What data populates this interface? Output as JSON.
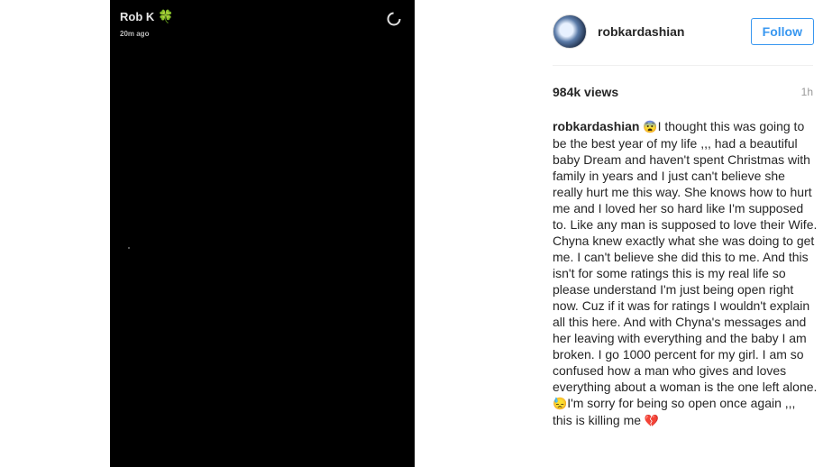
{
  "video_overlay": {
    "name": "Rob K",
    "name_emoji": "🍀",
    "timestamp": "20m ago"
  },
  "header": {
    "username": "robkardashian",
    "follow_label": "Follow"
  },
  "stats": {
    "views": "984k views",
    "age": "1h"
  },
  "caption": {
    "author": "robkardashian",
    "emoji_1": "😨",
    "text_1": "I thought this was going to be the best year of my life ,,, had a beautiful baby Dream and haven't spent Christmas with family in years and I just can't believe she really hurt me this way. She knows how to hurt me and I loved her so hard like I'm supposed to. Like any man is supposed to love their Wife. Chyna knew exactly what she was doing to get me. I can't believe she did this to me. And this isn't for some ratings this is my real life so please understand I'm just being open right now. Cuz if it was for ratings I wouldn't explain all this here. And with Chyna's messages and her leaving with everything and the baby I am broken. I go 1000 percent for my girl. I am so confused how a man who gives and loves everything about a woman is the one left alone. ",
    "emoji_2": "😓",
    "text_2": "I'm sorry for being so open once again ,,, this is killing me ",
    "emoji_3": "💔"
  },
  "colors": {
    "follow_blue": "#3897f0",
    "video_bg": "#000000",
    "muted_text": "#999999"
  },
  "icons": {
    "loading": "loading-spinner-icon",
    "clover": "four-leaf-clover"
  }
}
